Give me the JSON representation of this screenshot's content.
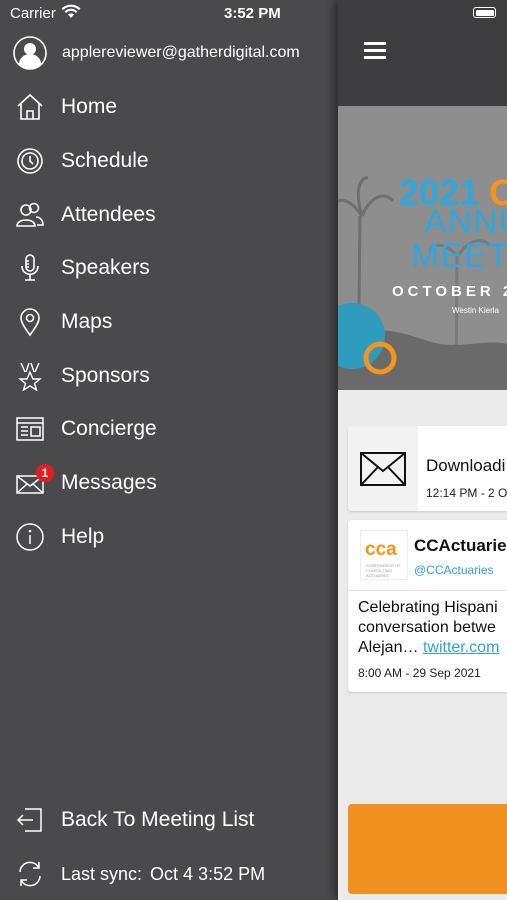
{
  "status_bar": {
    "carrier": "Carrier",
    "time": "3:52 PM"
  },
  "drawer": {
    "user_email": "applereviewer@gatherdigital.com",
    "items": [
      {
        "label": "Home",
        "icon": "home-icon"
      },
      {
        "label": "Schedule",
        "icon": "clock-icon"
      },
      {
        "label": "Attendees",
        "icon": "people-icon"
      },
      {
        "label": "Speakers",
        "icon": "microphone-icon"
      },
      {
        "label": "Maps",
        "icon": "map-pin-icon"
      },
      {
        "label": "Sponsors",
        "icon": "sponsor-star-icon"
      },
      {
        "label": "Concierge",
        "icon": "concierge-icon"
      },
      {
        "label": "Messages",
        "icon": "envelope-icon",
        "badge": "1"
      },
      {
        "label": "Help",
        "icon": "info-icon"
      }
    ],
    "back_label": "Back To Meeting List",
    "sync_label": "Last sync:",
    "sync_value": "Oct 4 3:52 PM"
  },
  "main": {
    "banner": {
      "year": "2021",
      "org_letter": "C",
      "line2": "ANNU",
      "line3": "MEETI",
      "date": "OCTOBER 2",
      "venue": "Westin Kierla"
    },
    "download_card": {
      "title": "Downloadi",
      "time": "12:14 PM - 2 O"
    },
    "tweet_card": {
      "logo_text": "cca",
      "logo_sub": "CONFERENCE OF CONSULTING ACTUARIES",
      "name": "CCActuarie",
      "handle": "@CCActuaries",
      "body_line1": "Celebrating Hispani",
      "body_line2": "conversation betwe",
      "body_line3": "Alejan…",
      "link_text": "twitter.com",
      "time": "8:00 AM - 29 Sep 2021"
    }
  },
  "colors": {
    "drawer_bg": "#4a4a4d",
    "accent_blue": "#30a7de",
    "accent_orange": "#f7941d",
    "badge_red": "#e51c23"
  }
}
